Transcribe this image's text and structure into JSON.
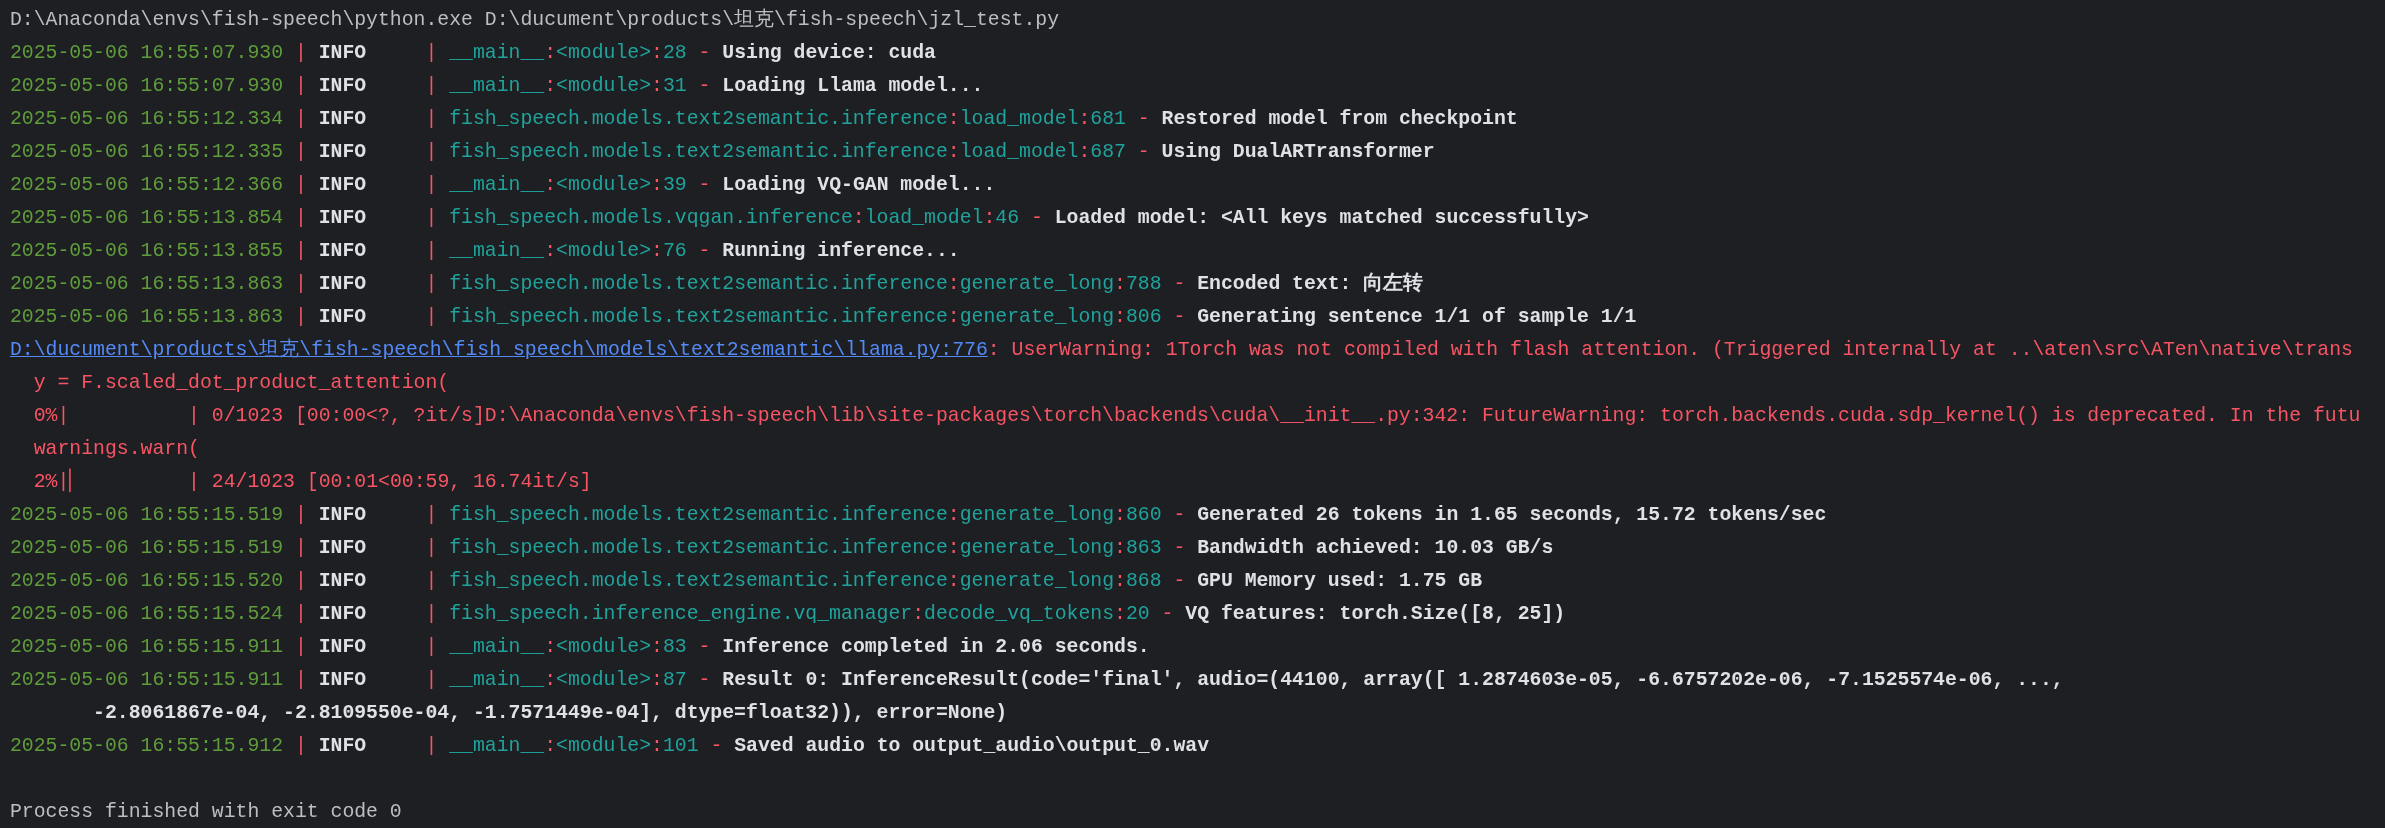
{
  "console": {
    "lines": [
      {
        "kind": "text",
        "segments": [
          {
            "kind": "plain",
            "text": "D:\\Anaconda\\envs\\fish-speech\\python.exe D:\\ducument\\products\\坦克\\fish-speech\\jzl_test.py"
          }
        ]
      },
      {
        "kind": "text",
        "segments": [
          {
            "kind": "time",
            "text": "2025-05-06 16:55:07.930"
          },
          {
            "kind": "sep",
            "text": " | "
          },
          {
            "kind": "level",
            "text": "INFO    "
          },
          {
            "kind": "sep",
            "text": " | "
          },
          {
            "kind": "src",
            "text": "__main__"
          },
          {
            "kind": "sep",
            "text": ":"
          },
          {
            "kind": "src",
            "text": "<module>"
          },
          {
            "kind": "sep",
            "text": ":"
          },
          {
            "kind": "src",
            "text": "28"
          },
          {
            "kind": "sep",
            "text": " - "
          },
          {
            "kind": "msg",
            "text": "Using device: cuda"
          }
        ]
      },
      {
        "kind": "text",
        "segments": [
          {
            "kind": "time",
            "text": "2025-05-06 16:55:07.930"
          },
          {
            "kind": "sep",
            "text": " | "
          },
          {
            "kind": "level",
            "text": "INFO    "
          },
          {
            "kind": "sep",
            "text": " | "
          },
          {
            "kind": "src",
            "text": "__main__"
          },
          {
            "kind": "sep",
            "text": ":"
          },
          {
            "kind": "src",
            "text": "<module>"
          },
          {
            "kind": "sep",
            "text": ":"
          },
          {
            "kind": "src",
            "text": "31"
          },
          {
            "kind": "sep",
            "text": " - "
          },
          {
            "kind": "msg",
            "text": "Loading Llama model..."
          }
        ]
      },
      {
        "kind": "text",
        "segments": [
          {
            "kind": "time",
            "text": "2025-05-06 16:55:12.334"
          },
          {
            "kind": "sep",
            "text": " | "
          },
          {
            "kind": "level",
            "text": "INFO    "
          },
          {
            "kind": "sep",
            "text": " | "
          },
          {
            "kind": "src",
            "text": "fish_speech.models.text2semantic.inference"
          },
          {
            "kind": "sep",
            "text": ":"
          },
          {
            "kind": "src",
            "text": "load_model"
          },
          {
            "kind": "sep",
            "text": ":"
          },
          {
            "kind": "src",
            "text": "681"
          },
          {
            "kind": "sep",
            "text": " - "
          },
          {
            "kind": "msg",
            "text": "Restored model from checkpoint"
          }
        ]
      },
      {
        "kind": "text",
        "segments": [
          {
            "kind": "time",
            "text": "2025-05-06 16:55:12.335"
          },
          {
            "kind": "sep",
            "text": " | "
          },
          {
            "kind": "level",
            "text": "INFO    "
          },
          {
            "kind": "sep",
            "text": " | "
          },
          {
            "kind": "src",
            "text": "fish_speech.models.text2semantic.inference"
          },
          {
            "kind": "sep",
            "text": ":"
          },
          {
            "kind": "src",
            "text": "load_model"
          },
          {
            "kind": "sep",
            "text": ":"
          },
          {
            "kind": "src",
            "text": "687"
          },
          {
            "kind": "sep",
            "text": " - "
          },
          {
            "kind": "msg",
            "text": "Using DualARTransformer"
          }
        ]
      },
      {
        "kind": "text",
        "segments": [
          {
            "kind": "time",
            "text": "2025-05-06 16:55:12.366"
          },
          {
            "kind": "sep",
            "text": " | "
          },
          {
            "kind": "level",
            "text": "INFO    "
          },
          {
            "kind": "sep",
            "text": " | "
          },
          {
            "kind": "src",
            "text": "__main__"
          },
          {
            "kind": "sep",
            "text": ":"
          },
          {
            "kind": "src",
            "text": "<module>"
          },
          {
            "kind": "sep",
            "text": ":"
          },
          {
            "kind": "src",
            "text": "39"
          },
          {
            "kind": "sep",
            "text": " - "
          },
          {
            "kind": "msg",
            "text": "Loading VQ-GAN model..."
          }
        ]
      },
      {
        "kind": "text",
        "segments": [
          {
            "kind": "time",
            "text": "2025-05-06 16:55:13.854"
          },
          {
            "kind": "sep",
            "text": " | "
          },
          {
            "kind": "level",
            "text": "INFO    "
          },
          {
            "kind": "sep",
            "text": " | "
          },
          {
            "kind": "src",
            "text": "fish_speech.models.vqgan.inference"
          },
          {
            "kind": "sep",
            "text": ":"
          },
          {
            "kind": "src",
            "text": "load_model"
          },
          {
            "kind": "sep",
            "text": ":"
          },
          {
            "kind": "src",
            "text": "46"
          },
          {
            "kind": "sep",
            "text": " - "
          },
          {
            "kind": "msg",
            "text": "Loaded model: <All keys matched successfully>"
          }
        ]
      },
      {
        "kind": "text",
        "segments": [
          {
            "kind": "time",
            "text": "2025-05-06 16:55:13.855"
          },
          {
            "kind": "sep",
            "text": " | "
          },
          {
            "kind": "level",
            "text": "INFO    "
          },
          {
            "kind": "sep",
            "text": " | "
          },
          {
            "kind": "src",
            "text": "__main__"
          },
          {
            "kind": "sep",
            "text": ":"
          },
          {
            "kind": "src",
            "text": "<module>"
          },
          {
            "kind": "sep",
            "text": ":"
          },
          {
            "kind": "src",
            "text": "76"
          },
          {
            "kind": "sep",
            "text": " - "
          },
          {
            "kind": "msg",
            "text": "Running inference..."
          }
        ]
      },
      {
        "kind": "text",
        "segments": [
          {
            "kind": "time",
            "text": "2025-05-06 16:55:13.863"
          },
          {
            "kind": "sep",
            "text": " | "
          },
          {
            "kind": "level",
            "text": "INFO    "
          },
          {
            "kind": "sep",
            "text": " | "
          },
          {
            "kind": "src",
            "text": "fish_speech.models.text2semantic.inference"
          },
          {
            "kind": "sep",
            "text": ":"
          },
          {
            "kind": "src",
            "text": "generate_long"
          },
          {
            "kind": "sep",
            "text": ":"
          },
          {
            "kind": "src",
            "text": "788"
          },
          {
            "kind": "sep",
            "text": " - "
          },
          {
            "kind": "msg",
            "text": "Encoded text: 向左转"
          }
        ]
      },
      {
        "kind": "text",
        "segments": [
          {
            "kind": "time",
            "text": "2025-05-06 16:55:13.863"
          },
          {
            "kind": "sep",
            "text": " | "
          },
          {
            "kind": "level",
            "text": "INFO    "
          },
          {
            "kind": "sep",
            "text": " | "
          },
          {
            "kind": "src",
            "text": "fish_speech.models.text2semantic.inference"
          },
          {
            "kind": "sep",
            "text": ":"
          },
          {
            "kind": "src",
            "text": "generate_long"
          },
          {
            "kind": "sep",
            "text": ":"
          },
          {
            "kind": "src",
            "text": "806"
          },
          {
            "kind": "sep",
            "text": " - "
          },
          {
            "kind": "msg",
            "text": "Generating sentence 1/1 of sample 1/1"
          }
        ]
      },
      {
        "kind": "text",
        "segments": [
          {
            "kind": "link",
            "text": "D:\\ducument\\products\\坦克\\fish-speech\\fish_speech\\models\\text2semantic\\llama.py:776"
          },
          {
            "kind": "warn",
            "text": ": UserWarning: 1Torch was not compiled with flash attention. (Triggered internally at ..\\aten\\src\\ATen\\native\\trans"
          }
        ]
      },
      {
        "kind": "text",
        "segments": [
          {
            "kind": "warn",
            "text": "  y = F.scaled_dot_product_attention("
          }
        ]
      },
      {
        "kind": "text",
        "segments": [
          {
            "kind": "warn",
            "text": "  0%|          | 0/1023 [00:00<?, ?it/s]D:\\Anaconda\\envs\\fish-speech\\lib\\site-packages\\torch\\backends\\cuda\\__init__.py:342: FutureWarning: torch.backends.cuda.sdp_kernel() is deprecated. In the futu"
          }
        ]
      },
      {
        "kind": "text",
        "segments": [
          {
            "kind": "warn",
            "text": "  warnings.warn("
          }
        ]
      },
      {
        "kind": "text",
        "segments": [
          {
            "kind": "warn",
            "text": "  2%|▏         | 24/1023 [00:01<00:59, 16.74it/s]"
          }
        ]
      },
      {
        "kind": "text",
        "segments": [
          {
            "kind": "time",
            "text": "2025-05-06 16:55:15.519"
          },
          {
            "kind": "sep",
            "text": " | "
          },
          {
            "kind": "level",
            "text": "INFO    "
          },
          {
            "kind": "sep",
            "text": " | "
          },
          {
            "kind": "src",
            "text": "fish_speech.models.text2semantic.inference"
          },
          {
            "kind": "sep",
            "text": ":"
          },
          {
            "kind": "src",
            "text": "generate_long"
          },
          {
            "kind": "sep",
            "text": ":"
          },
          {
            "kind": "src",
            "text": "860"
          },
          {
            "kind": "sep",
            "text": " - "
          },
          {
            "kind": "msg",
            "text": "Generated 26 tokens in 1.65 seconds, 15.72 tokens/sec"
          }
        ]
      },
      {
        "kind": "text",
        "segments": [
          {
            "kind": "time",
            "text": "2025-05-06 16:55:15.519"
          },
          {
            "kind": "sep",
            "text": " | "
          },
          {
            "kind": "level",
            "text": "INFO    "
          },
          {
            "kind": "sep",
            "text": " | "
          },
          {
            "kind": "src",
            "text": "fish_speech.models.text2semantic.inference"
          },
          {
            "kind": "sep",
            "text": ":"
          },
          {
            "kind": "src",
            "text": "generate_long"
          },
          {
            "kind": "sep",
            "text": ":"
          },
          {
            "kind": "src",
            "text": "863"
          },
          {
            "kind": "sep",
            "text": " - "
          },
          {
            "kind": "msg",
            "text": "Bandwidth achieved: 10.03 GB/s"
          }
        ]
      },
      {
        "kind": "text",
        "segments": [
          {
            "kind": "time",
            "text": "2025-05-06 16:55:15.520"
          },
          {
            "kind": "sep",
            "text": " | "
          },
          {
            "kind": "level",
            "text": "INFO    "
          },
          {
            "kind": "sep",
            "text": " | "
          },
          {
            "kind": "src",
            "text": "fish_speech.models.text2semantic.inference"
          },
          {
            "kind": "sep",
            "text": ":"
          },
          {
            "kind": "src",
            "text": "generate_long"
          },
          {
            "kind": "sep",
            "text": ":"
          },
          {
            "kind": "src",
            "text": "868"
          },
          {
            "kind": "sep",
            "text": " - "
          },
          {
            "kind": "msg",
            "text": "GPU Memory used: 1.75 GB"
          }
        ]
      },
      {
        "kind": "text",
        "segments": [
          {
            "kind": "time",
            "text": "2025-05-06 16:55:15.524"
          },
          {
            "kind": "sep",
            "text": " | "
          },
          {
            "kind": "level",
            "text": "INFO    "
          },
          {
            "kind": "sep",
            "text": " | "
          },
          {
            "kind": "src",
            "text": "fish_speech.inference_engine.vq_manager"
          },
          {
            "kind": "sep",
            "text": ":"
          },
          {
            "kind": "src",
            "text": "decode_vq_tokens"
          },
          {
            "kind": "sep",
            "text": ":"
          },
          {
            "kind": "src",
            "text": "20"
          },
          {
            "kind": "sep",
            "text": " - "
          },
          {
            "kind": "msg",
            "text": "VQ features: torch.Size([8, 25])"
          }
        ]
      },
      {
        "kind": "text",
        "segments": [
          {
            "kind": "time",
            "text": "2025-05-06 16:55:15.911"
          },
          {
            "kind": "sep",
            "text": " | "
          },
          {
            "kind": "level",
            "text": "INFO    "
          },
          {
            "kind": "sep",
            "text": " | "
          },
          {
            "kind": "src",
            "text": "__main__"
          },
          {
            "kind": "sep",
            "text": ":"
          },
          {
            "kind": "src",
            "text": "<module>"
          },
          {
            "kind": "sep",
            "text": ":"
          },
          {
            "kind": "src",
            "text": "83"
          },
          {
            "kind": "sep",
            "text": " - "
          },
          {
            "kind": "msg",
            "text": "Inference completed in 2.06 seconds."
          }
        ]
      },
      {
        "kind": "text",
        "segments": [
          {
            "kind": "time",
            "text": "2025-05-06 16:55:15.911"
          },
          {
            "kind": "sep",
            "text": " | "
          },
          {
            "kind": "level",
            "text": "INFO    "
          },
          {
            "kind": "sep",
            "text": " | "
          },
          {
            "kind": "src",
            "text": "__main__"
          },
          {
            "kind": "sep",
            "text": ":"
          },
          {
            "kind": "src",
            "text": "<module>"
          },
          {
            "kind": "sep",
            "text": ":"
          },
          {
            "kind": "src",
            "text": "87"
          },
          {
            "kind": "sep",
            "text": " - "
          },
          {
            "kind": "msg",
            "text": "Result 0: InferenceResult(code='final', audio=(44100, array([ 1.2874603e-05, -6.6757202e-06, -7.1525574e-06, ...,"
          }
        ]
      },
      {
        "kind": "text",
        "segments": [
          {
            "kind": "msg",
            "text": "       -2.8061867e-04, -2.8109550e-04, -1.7571449e-04], dtype=float32)), error=None)"
          }
        ]
      },
      {
        "kind": "text",
        "segments": [
          {
            "kind": "time",
            "text": "2025-05-06 16:55:15.912"
          },
          {
            "kind": "sep",
            "text": " | "
          },
          {
            "kind": "level",
            "text": "INFO    "
          },
          {
            "kind": "sep",
            "text": " | "
          },
          {
            "kind": "src",
            "text": "__main__"
          },
          {
            "kind": "sep",
            "text": ":"
          },
          {
            "kind": "src",
            "text": "<module>"
          },
          {
            "kind": "sep",
            "text": ":"
          },
          {
            "kind": "src",
            "text": "101"
          },
          {
            "kind": "sep",
            "text": " - "
          },
          {
            "kind": "msg",
            "text": "Saved audio to output_audio\\output_0.wav"
          }
        ]
      },
      {
        "kind": "blank"
      },
      {
        "kind": "text",
        "segments": [
          {
            "kind": "plain",
            "text": "Process finished with exit code 0"
          }
        ]
      }
    ]
  }
}
